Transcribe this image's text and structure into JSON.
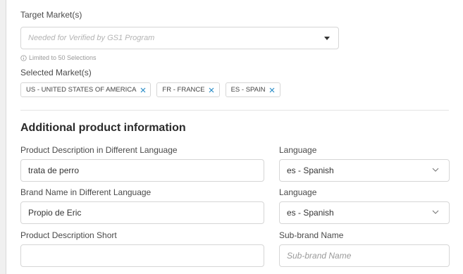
{
  "target_market": {
    "label": "Target Market(s)",
    "placeholder": "Needed for Verified by GS1 Program",
    "hint": "Limited to 50 Selections"
  },
  "selected_markets": {
    "label": "Selected Market(s)",
    "chips": [
      {
        "label": "US - UNITED STATES OF AMERICA"
      },
      {
        "label": "FR - FRANCE"
      },
      {
        "label": "ES - SPAIN"
      }
    ]
  },
  "additional_info": {
    "title": "Additional product information",
    "product_description_diff_lang": {
      "label": "Product Description in Different Language",
      "value": "trata de perro"
    },
    "language_1": {
      "label": "Language",
      "value": "es - Spanish"
    },
    "brand_name_diff_lang": {
      "label": "Brand Name in Different Language",
      "value": "Propio de Eric"
    },
    "language_2": {
      "label": "Language",
      "value": "es - Spanish"
    },
    "product_description_short": {
      "label": "Product Description Short",
      "value": ""
    },
    "sub_brand_name": {
      "label": "Sub-brand Name",
      "placeholder": "Sub-brand Name"
    }
  },
  "colors": {
    "chip_remove": "#2f8fc8",
    "border": "#d6d6d6"
  },
  "icons": {
    "hint": "info-circle-icon",
    "target_dropdown": "caret-down-icon",
    "language_dropdown": "chevron-down-icon",
    "chip_remove": "close-icon"
  }
}
